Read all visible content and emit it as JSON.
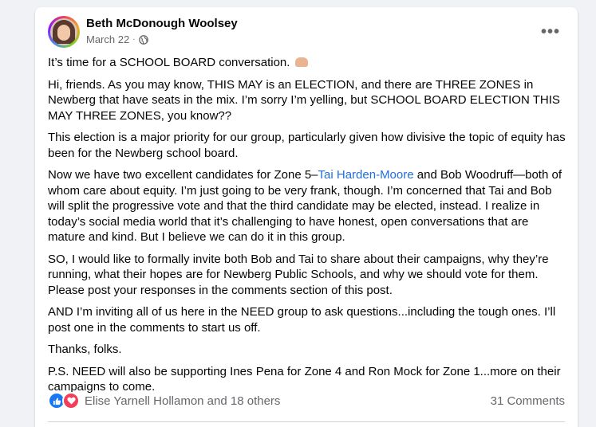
{
  "post": {
    "author": "Beth McDonough Woolsey",
    "date": "March 22",
    "dot": "·",
    "more": "•••",
    "paragraphs": [
      "It’s time for a SCHOOL BOARD conversation.",
      "Hi, friends. As you may know, THIS MAY is an ELECTION, and there are THREE ZONES in Newberg that have seats in the mix. I’m sorry I’m yelling, but SCHOOL BOARD ELECTION THIS MAY THREE ZONES, you know??",
      "This election is a major priority for our group, particularly given how divisive the topic of equity has been for the Newberg school board.",
      "SO, I would like to formally invite both Bob and Tai to share about their campaigns, why they’re running, what their hopes are for Newberg Public Schools, and why we should vote for them. Please post your responses in the comments section of this post.",
      "AND I’m inviting all of us here in the NEED group to ask questions...including the tough ones. I’ll post one in the comments to start us off.",
      "Thanks, folks.",
      "P.S. NEED will also be supporting Ines Pena for Zone 4 and Ron Mock for Zone 1...more on their campaigns to come."
    ],
    "zone_paragraph": {
      "before": "Now we have two excellent candidates for Zone 5–",
      "link": "Tai Harden-Moore",
      "after": " and Bob Woodruff—both of whom care about equity. I’m just going to be very frank, though. I’m concerned that Tai and Bob will split the progressive vote and that the third candidate may be elected, instead. I realize in today’s social media world that it’s challenging to have honest, open conversations that are mature and kind. But I believe we can do it in this group."
    },
    "reactions_text": "Elise Yarnell Hollamon and 18 others",
    "comments_text": "31 Comments"
  },
  "colors": {
    "link": "#216fdb",
    "like": "#1877f2",
    "love": "#f33e58",
    "secondary_text": "#65676b"
  },
  "icons": [
    "avatar",
    "globe-icon",
    "more-icon",
    "raised-hands-emoji",
    "like-icon",
    "love-icon"
  ]
}
